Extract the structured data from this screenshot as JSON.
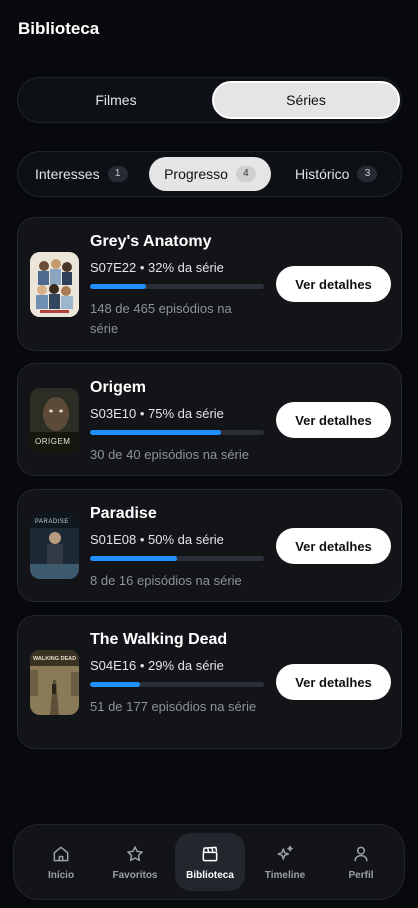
{
  "header": {
    "title": "Biblioteca"
  },
  "segment": {
    "left_label": "Filmes",
    "right_label": "Séries",
    "active": "Séries"
  },
  "tabs": [
    {
      "label": "Interesses",
      "count": "1"
    },
    {
      "label": "Progresso",
      "count": "4"
    },
    {
      "label": "Histórico",
      "count": "3"
    }
  ],
  "accent_color": "#1e90ff",
  "button_label": "Ver detalhes",
  "series": [
    {
      "title": "Grey's Anatomy",
      "meta": "S07E22 • 32% da série",
      "progress": 0.32,
      "episodes": "148 de 465 episódios na série"
    },
    {
      "title": "Origem",
      "meta": "S03E10 • 75% da série",
      "progress": 0.75,
      "episodes": "30 de 40 episódios na série"
    },
    {
      "title": "Paradise",
      "meta": "S01E08 • 50% da série",
      "progress": 0.5,
      "episodes": "8 de 16 episódios na série"
    },
    {
      "title": "The Walking Dead",
      "meta": "S04E16 • 29% da série",
      "progress": 0.29,
      "episodes": "51 de 177 episódios na série"
    }
  ],
  "posters": {
    "origem_text": "ORIGEM",
    "paradise_text": "PARADISE",
    "walking_dead_text": "WALKING DEAD"
  },
  "nav": [
    {
      "label": "Início",
      "icon": "home-icon"
    },
    {
      "label": "Favoritos",
      "icon": "star-icon"
    },
    {
      "label": "Biblioteca",
      "icon": "clapperboard-icon"
    },
    {
      "label": "Timeline",
      "icon": "sparkles-icon"
    },
    {
      "label": "Perfil",
      "icon": "user-icon"
    }
  ]
}
